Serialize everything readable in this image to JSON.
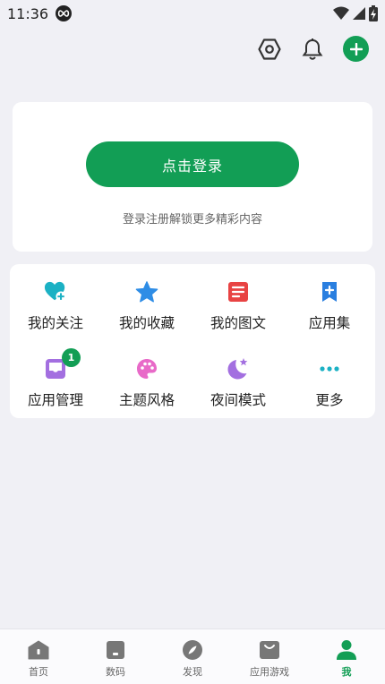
{
  "status_bar": {
    "time": "11:36"
  },
  "login": {
    "button_label": "点击登录",
    "hint": "登录注册解锁更多精彩内容"
  },
  "menu": [
    {
      "label": "我的关注",
      "icon": "heart-plus-icon",
      "color": "#1bb1c4"
    },
    {
      "label": "我的收藏",
      "icon": "star-icon",
      "color": "#2e8de6"
    },
    {
      "label": "我的图文",
      "icon": "article-icon",
      "color": "#e84343"
    },
    {
      "label": "应用集",
      "icon": "bookmark-plus-icon",
      "color": "#2a7fe0"
    },
    {
      "label": "应用管理",
      "icon": "tray-icon",
      "color": "#a36fe0",
      "badge": "1"
    },
    {
      "label": "主题风格",
      "icon": "palette-icon",
      "color": "#e86ac8"
    },
    {
      "label": "夜间模式",
      "icon": "moon-star-icon",
      "color": "#a36fe0"
    },
    {
      "label": "更多",
      "icon": "more-dots-icon",
      "color": "#1bb1c4"
    }
  ],
  "bottom_nav": [
    {
      "label": "首页",
      "icon": "home-icon"
    },
    {
      "label": "数码",
      "icon": "device-icon"
    },
    {
      "label": "发现",
      "icon": "compass-icon"
    },
    {
      "label": "应用游戏",
      "icon": "shopping-bag-icon"
    },
    {
      "label": "我",
      "icon": "person-icon",
      "active": true
    }
  ],
  "colors": {
    "accent": "#129e55",
    "background": "#f0f0f5",
    "nav_inactive": "#777777"
  }
}
